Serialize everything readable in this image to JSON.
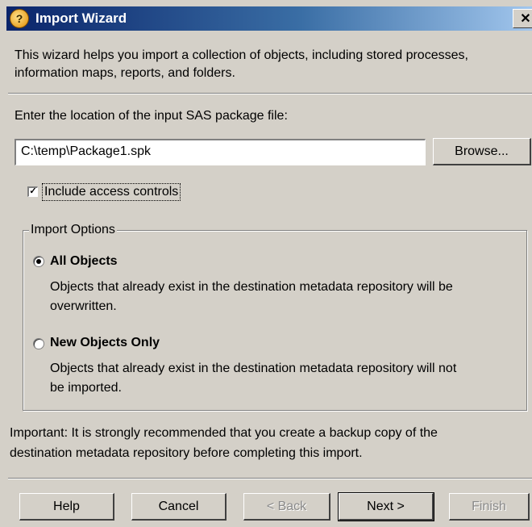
{
  "window": {
    "title": "Import Wizard",
    "close_glyph": "✕"
  },
  "intro": {
    "line1": "This wizard helps you import a collection of objects, including stored processes,",
    "line2": "information maps, reports, and folders."
  },
  "location": {
    "label": "Enter the location of the input SAS package file:",
    "value": "C:\\temp\\Package1.spk",
    "browse_label": "Browse..."
  },
  "access_controls": {
    "label": "Include access controls",
    "checked": true
  },
  "import_options": {
    "legend": "Import Options",
    "selected": "All Objects",
    "options": [
      {
        "label": "All Objects",
        "desc_line1": "Objects that already exist in the destination metadata repository will be",
        "desc_line2": "overwritten."
      },
      {
        "label": "New Objects Only",
        "desc_line1": "Objects that already exist in the destination metadata repository will not",
        "desc_line2": "be imported."
      }
    ]
  },
  "important": {
    "line1": "Important: It is strongly recommended that you create a backup copy of the",
    "line2": "destination metadata repository before completing this import."
  },
  "footer": {
    "help": "Help",
    "cancel": "Cancel",
    "back": "< Back",
    "next": "Next >",
    "finish": "Finish"
  },
  "icons": {
    "app": "import-wizard-icon",
    "check": "✓"
  }
}
